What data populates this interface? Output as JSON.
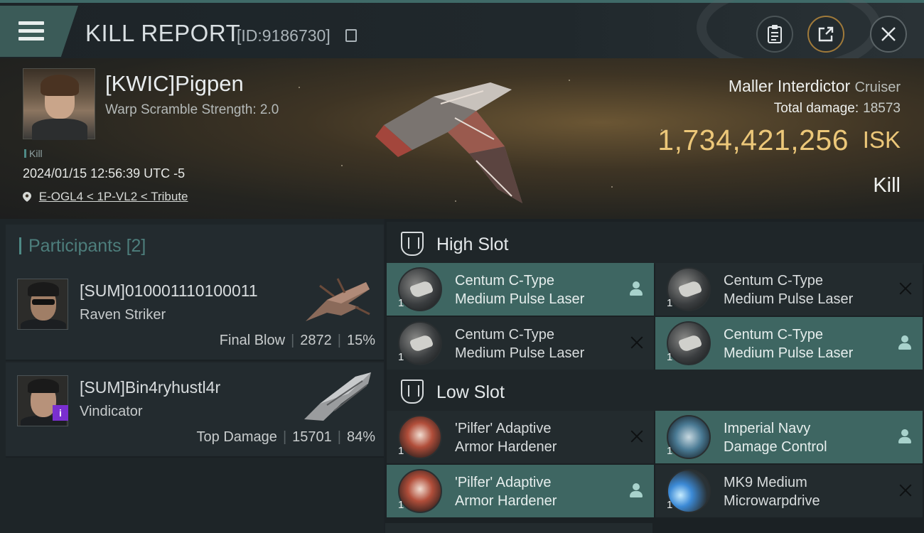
{
  "header": {
    "title": "KILL REPORT",
    "report_id": "[ID:9186730]"
  },
  "victim": {
    "name": "[KWIC]Pigpen",
    "subtitle": "Warp Scramble Strength: 2.0",
    "tag": "Kill",
    "datetime": "2024/01/15 12:56:39 UTC -5",
    "location": "E-OGL4 < 1P-VL2 < Tribute",
    "ship_name": "Maller Interdictor",
    "ship_class": "Cruiser",
    "total_damage_label": "Total damage:",
    "total_damage": "18573",
    "isk_value": "1,734,421,256",
    "isk_unit": "ISK",
    "result": "Kill"
  },
  "participants": {
    "label": "Participants",
    "count": "[2]",
    "items": [
      {
        "name": "[SUM]010001110100011",
        "ship": "Raven Striker",
        "role": "Final Blow",
        "damage": "2872",
        "percent": "15%"
      },
      {
        "name": "[SUM]Bin4ryhustl4r",
        "ship": "Vindicator",
        "role": "Top Damage",
        "damage": "15701",
        "percent": "84%",
        "badge": "i"
      }
    ],
    "separator": "|"
  },
  "slots": {
    "high": {
      "title": "High Slot",
      "modules": [
        {
          "qty": "1",
          "name": "Centum C-Type\nMedium Pulse Laser",
          "fitted": true
        },
        {
          "qty": "1",
          "name": "Centum C-Type\nMedium Pulse Laser",
          "fitted": false
        },
        {
          "qty": "1",
          "name": "Centum C-Type\nMedium Pulse Laser",
          "fitted": false
        },
        {
          "qty": "1",
          "name": "Centum C-Type\nMedium Pulse Laser",
          "fitted": true
        }
      ]
    },
    "low": {
      "title": "Low Slot",
      "modules": [
        {
          "qty": "1",
          "name": "'Pilfer' Adaptive\nArmor Hardener",
          "fitted": false
        },
        {
          "qty": "1",
          "name": "Imperial Navy\nDamage Control",
          "fitted": true
        },
        {
          "qty": "1",
          "name": "'Pilfer' Adaptive\nArmor Hardener",
          "fitted": true
        },
        {
          "qty": "1",
          "name": "MK9 Medium\nMicrowarpdrive",
          "fitted": false
        }
      ]
    }
  },
  "icons": {
    "menu": "menu-icon",
    "copy": "copy-icon",
    "clipboard": "clipboard-icon",
    "share": "share-icon",
    "close": "close-icon",
    "location": "location-pin-icon",
    "person": "person-icon",
    "x": "x-icon"
  },
  "colors": {
    "accent_teal": "#3e6662",
    "isk_gold": "#ecc779",
    "participants_label": "#4d7e7c"
  }
}
